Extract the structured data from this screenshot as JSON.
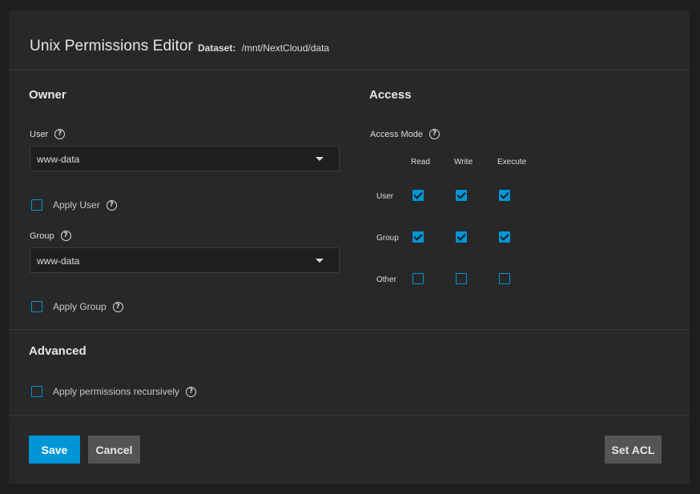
{
  "header": {
    "title": "Unix Permissions Editor",
    "dataset_label": "Dataset:",
    "dataset_path": "/mnt/NextCloud/data"
  },
  "owner": {
    "section_title": "Owner",
    "user_label": "User",
    "user_value": "www-data",
    "apply_user_label": "Apply User",
    "apply_user_checked": false,
    "group_label": "Group",
    "group_value": "www-data",
    "apply_group_label": "Apply Group",
    "apply_group_checked": false
  },
  "access": {
    "section_title": "Access",
    "mode_label": "Access Mode",
    "columns": [
      "Read",
      "Write",
      "Execute"
    ],
    "rows": [
      {
        "label": "User",
        "values": [
          true,
          true,
          true
        ]
      },
      {
        "label": "Group",
        "values": [
          true,
          true,
          true
        ]
      },
      {
        "label": "Other",
        "values": [
          false,
          false,
          false
        ]
      }
    ]
  },
  "advanced": {
    "section_title": "Advanced",
    "recursive_label": "Apply permissions recursively",
    "recursive_checked": false
  },
  "actions": {
    "save": "Save",
    "cancel": "Cancel",
    "set_acl": "Set ACL"
  },
  "colors": {
    "accent": "#0095d5",
    "background": "#282828",
    "button_gray": "#545454"
  },
  "icons": {
    "help": "help-circle-icon",
    "dropdown": "chevron-down-icon",
    "checkbox_checked": "check-icon"
  }
}
